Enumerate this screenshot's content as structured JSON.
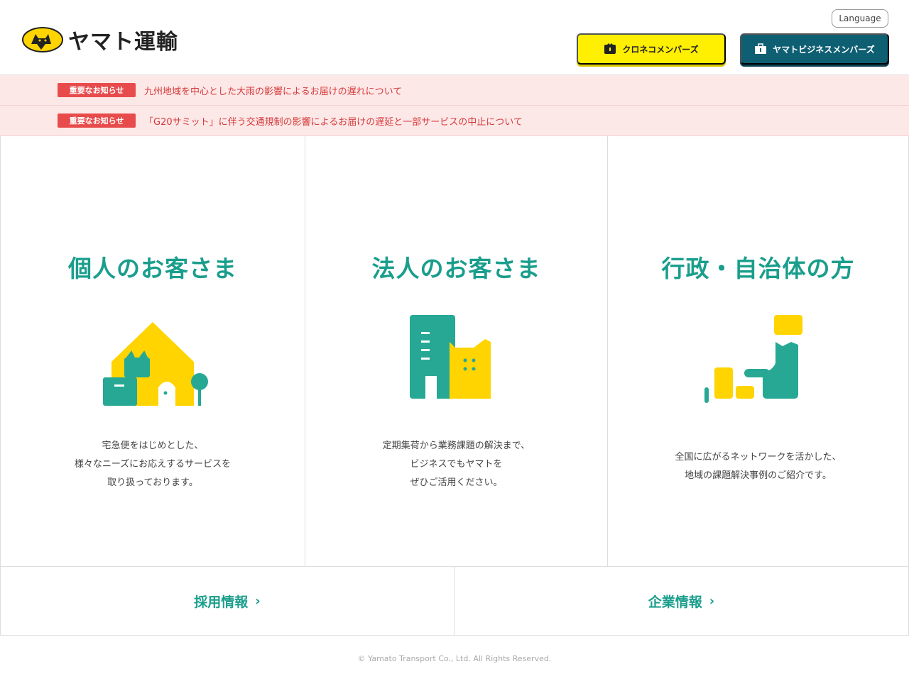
{
  "header": {
    "logo_text": "ヤマト運輸",
    "language_label": "Language",
    "kuroneko_label": "クロネコメンバーズ",
    "business_label": "ヤマトビジネスメンバーズ"
  },
  "notices": [
    {
      "badge": "重要なお知らせ",
      "text": "九州地域を中心とした大雨の影響によるお届けの遅れについて"
    },
    {
      "badge": "重要なお知らせ",
      "text": "「G20サミット」に伴う交通規制の影響によるお届けの遅延と一部サービスの中止について"
    }
  ],
  "panels": [
    {
      "title": "個人のお客さま",
      "desc": [
        "宅急便をはじめとした、",
        "様々なニーズにお応えするサービスを",
        "取り扱っております。"
      ]
    },
    {
      "title": "法人のお客さま",
      "desc": [
        "定期集荷から業務課題の解決まで、",
        "ビジネスでもヤマトを",
        "ぜひご活用ください。"
      ]
    },
    {
      "title": "行政・自治体の方",
      "desc": [
        "全国に広がるネットワークを活かした、",
        "地域の課題解決事例のご紹介です。"
      ]
    }
  ],
  "bottom_links": [
    {
      "label": "採用情報",
      "chevron": "›"
    },
    {
      "label": "企業情報",
      "chevron": "›"
    }
  ],
  "footer": {
    "copyright": "© Yamato Transport Co., Ltd. All Rights Reserved."
  },
  "colors": {
    "accent": "#1a9e8c",
    "yellow": "#ffd400",
    "notice_red": "#e84b4b",
    "notice_bg": "#fde8e8",
    "business_btn": "#0f5f73"
  },
  "icons": {
    "logo": "kuroneko-cat-logo",
    "kuroneko_btn": "cat-card-icon",
    "business_btn": "briefcase-icon",
    "panel1": "house-illustration",
    "panel2": "building-illustration",
    "panel3": "japan-map-illustration"
  }
}
